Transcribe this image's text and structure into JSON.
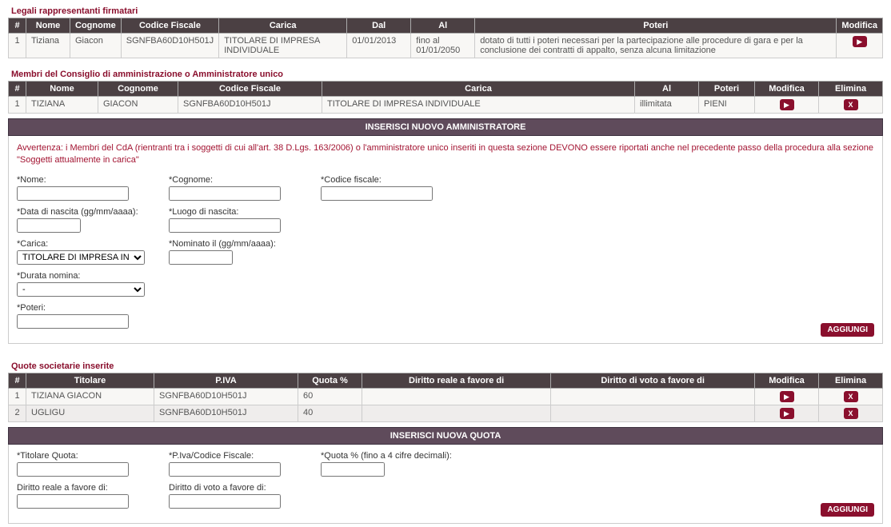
{
  "legal": {
    "title": "Legali rappresentanti firmatari",
    "headers": [
      "#",
      "Nome",
      "Cognome",
      "Codice Fiscale",
      "Carica",
      "Dal",
      "Al",
      "Poteri",
      "Modifica"
    ],
    "rows": [
      {
        "n": "1",
        "nome": "Tiziana",
        "cognome": "Giacon",
        "cf": "SGNFBA60D10H501J",
        "carica": "TITOLARE DI IMPRESA INDIVIDUALE",
        "dal": "01/01/2013",
        "al": "fino al 01/01/2050",
        "poteri": "dotato di tutti i poteri necessari per la partecipazione alle procedure di gara e per la conclusione dei contratti di appalto, senza alcuna limitazione"
      }
    ]
  },
  "board": {
    "title": "Membri del Consiglio di amministrazione o Amministratore unico",
    "headers": [
      "#",
      "Nome",
      "Cognome",
      "Codice Fiscale",
      "Carica",
      "Al",
      "Poteri",
      "Modifica",
      "Elimina"
    ],
    "rows": [
      {
        "n": "1",
        "nome": "TIZIANA",
        "cognome": "GIACON",
        "cf": "SGNFBA60D10H501J",
        "carica": "TITOLARE DI IMPRESA INDIVIDUALE",
        "al": "illimitata",
        "poteri": "PIENI"
      }
    ],
    "insertHeader": "INSERISCI NUOVO AMMINISTRATORE",
    "warning": "Avvertenza: i Membri del CdA (rientranti tra i soggetti di cui all'art. 38 D.Lgs. 163/2006) o l'amministratore unico inseriti in questa sezione DEVONO essere riportati anche nel precedente passo della procedura alla sezione \"Soggetti attualmente in carica\"",
    "labels": {
      "nome": "*Nome:",
      "cognome": "*Cognome:",
      "cf": "*Codice fiscale:",
      "dnasc": "*Data di nascita (gg/mm/aaaa):",
      "lnasc": "*Luogo di nascita:",
      "carica": "*Carica:",
      "caricaSelected": "TITOLARE DI IMPRESA INDIVIDUALE",
      "nominato": "*Nominato il (gg/mm/aaaa):",
      "durata": "*Durata nomina:",
      "durataSelected": "-",
      "poteri": "*Poteri:"
    },
    "addBtn": "AGGIUNGI"
  },
  "quotes": {
    "title": "Quote societarie inserite",
    "headers": [
      "#",
      "Titolare",
      "P.IVA",
      "Quota %",
      "Diritto reale a favore di",
      "Diritto di voto a favore di",
      "Modifica",
      "Elimina"
    ],
    "rows": [
      {
        "n": "1",
        "titolare": "TIZIANA GIACON",
        "piva": "SGNFBA60D10H501J",
        "quota": "60",
        "dr": "",
        "dv": ""
      },
      {
        "n": "2",
        "titolare": "UGLIGU",
        "piva": "SGNFBA60D10H501J",
        "quota": "40",
        "dr": "",
        "dv": ""
      }
    ],
    "insertHeader": "INSERISCI NUOVA QUOTA",
    "labels": {
      "titolare": "*Titolare Quota:",
      "piva": "*P.Iva/Codice Fiscale:",
      "quota": "*Quota % (fino a 4 cifre decimali):",
      "dr": "Diritto reale a favore di:",
      "dv": "Diritto di voto a favore di:"
    },
    "addBtn": "AGGIUNGI"
  }
}
